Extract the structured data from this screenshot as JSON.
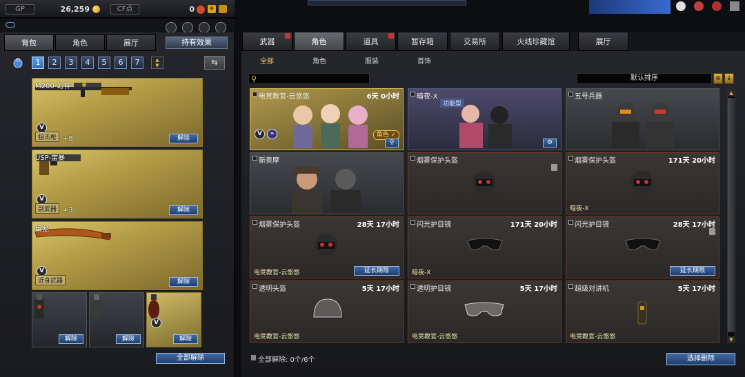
{
  "currency": {
    "gp_label": "GP",
    "gp_value": "26,259",
    "cf_label": "CF点",
    "cf_value": "0"
  },
  "left": {
    "tabs": [
      "背包",
      "角色",
      "展厅"
    ],
    "effect_button": "持有效果",
    "pages": [
      "1",
      "2",
      "3",
      "4",
      "5",
      "6",
      "7"
    ],
    "active_page": "1",
    "weapons": [
      {
        "name": "M200-幻神",
        "type": "狙击枪",
        "bonus": "+8",
        "unequip": "解除"
      },
      {
        "name": "USP-雷暴",
        "type": "副武器",
        "bonus": "+3",
        "unequip": "解除"
      },
      {
        "name": "屠龙",
        "type": "近身武器",
        "bonus": "",
        "unequip": "解除"
      }
    ],
    "throwables": [
      {
        "unequip": "解除"
      },
      {
        "unequip": "解除"
      },
      {
        "unequip": "解除"
      }
    ],
    "remove_all": "全部解除"
  },
  "right": {
    "tabs": [
      "武器",
      "角色",
      "道具",
      "暂存箱",
      "交易所",
      "火线珍藏馆",
      "展厅"
    ],
    "active_tab": "角色",
    "subtabs": [
      "全部",
      "角色",
      "服装",
      "首饰"
    ],
    "active_subtab": "全部",
    "sort_label": "默认排序",
    "items": [
      {
        "name": "电竞教官-云悠悠",
        "time": "6天 0小时",
        "owner": "",
        "role_tag": "角色 ✓"
      },
      {
        "name": "暗夜-X",
        "time": "",
        "owner": "",
        "tag": "功能型"
      },
      {
        "name": "五号兵器",
        "time": "",
        "owner": ""
      },
      {
        "name": "新奥摩",
        "time": "",
        "owner": ""
      },
      {
        "name": "烟雾保护头盔",
        "time": "",
        "owner": ""
      },
      {
        "name": "烟雾保护头盔",
        "time": "171天 20小时",
        "owner": "暗夜-X"
      },
      {
        "name": "烟雾保护头盔",
        "time": "28天 17小时",
        "owner": "电竞教官-云悠悠",
        "extend": "延长期限"
      },
      {
        "name": "闪光护目镜",
        "time": "171天 20小时",
        "owner": "暗夜-X"
      },
      {
        "name": "闪光护目镜",
        "time": "28天 17小时",
        "owner": "",
        "extend": "延长期限"
      },
      {
        "name": "透明头盔",
        "time": "5天 17小时",
        "owner": "电竞教官-云悠悠"
      },
      {
        "name": "透明护目镜",
        "time": "5天 17小时",
        "owner": "电竞教官-云悠悠"
      },
      {
        "name": "超级对讲机",
        "time": "5天 17小时",
        "owner": "电竞教官-云悠悠"
      }
    ],
    "footer_label": "全部解除: 0个/6个",
    "select_delete": "选择删除"
  }
}
